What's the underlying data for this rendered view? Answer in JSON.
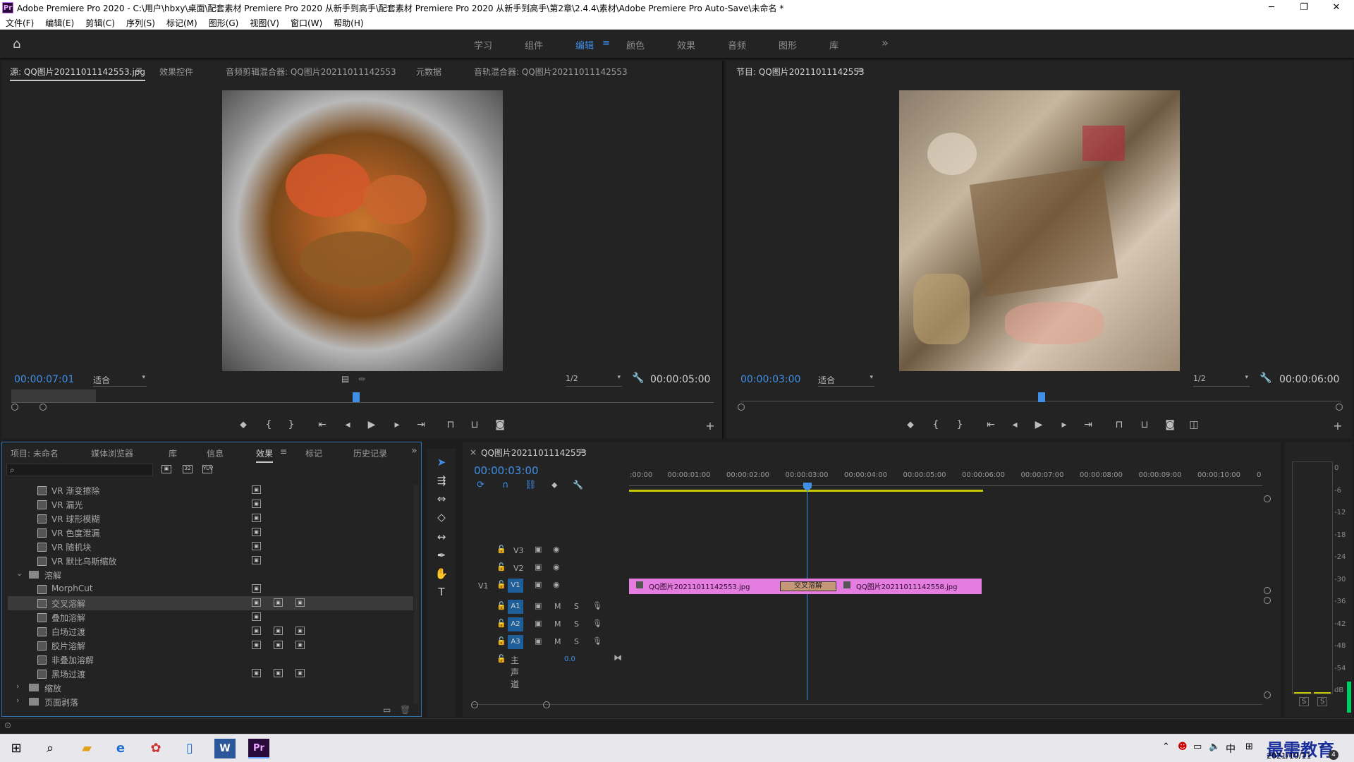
{
  "window": {
    "title": "Adobe Premiere Pro 2020 - C:\\用户\\hbxy\\桌面\\配套素材 Premiere Pro 2020 从新手到高手\\配套素材 Premiere Pro 2020 从新手到高手\\第2章\\2.4.4\\素材\\Adobe Premiere Pro Auto-Save\\未命名 *",
    "minimize": "─",
    "maximize": "❐",
    "close": "✕"
  },
  "menu": [
    "文件(F)",
    "编辑(E)",
    "剪辑(C)",
    "序列(S)",
    "标记(M)",
    "图形(G)",
    "视图(V)",
    "窗口(W)",
    "帮助(H)"
  ],
  "workspaces": [
    "学习",
    "组件",
    "编辑",
    "颜色",
    "效果",
    "音频",
    "图形",
    "库"
  ],
  "workspace_more": "»",
  "source": {
    "tabs": [
      "源: QQ图片20211011142553.jpg",
      "效果控件",
      "音频剪辑混合器: QQ图片20211011142553",
      "元数据",
      "音轨混合器: QQ图片20211011142553"
    ],
    "timecode": "00:00:07:01",
    "fit": "适合",
    "resolution": "1/2",
    "duration": "00:00:05:00"
  },
  "program": {
    "tab": "节目: QQ图片20211011142553",
    "timecode": "00:00:03:00",
    "fit": "适合",
    "resolution": "1/2",
    "duration": "00:00:06:00"
  },
  "project": {
    "tabs": [
      "项目: 未命名",
      "媒体浏览器",
      "库",
      "信息",
      "效果",
      "标记",
      "历史记录"
    ],
    "more": "»",
    "effects": [
      {
        "name": "VR 渐变擦除",
        "indent": 2,
        "badges": 1
      },
      {
        "name": "VR 漏光",
        "indent": 2,
        "badges": 1
      },
      {
        "name": "VR 球形模糊",
        "indent": 2,
        "badges": 1
      },
      {
        "name": "VR 色度泄漏",
        "indent": 2,
        "badges": 1
      },
      {
        "name": "VR 随机块",
        "indent": 2,
        "badges": 1
      },
      {
        "name": "VR 默比乌斯缩放",
        "indent": 2,
        "badges": 1
      },
      {
        "name": "溶解",
        "folder": true,
        "open": true
      },
      {
        "name": "MorphCut",
        "indent": 2,
        "badges": 1
      },
      {
        "name": "交叉溶解",
        "indent": 2,
        "badges": 3,
        "selected": true
      },
      {
        "name": "叠加溶解",
        "indent": 2,
        "badges": 1
      },
      {
        "name": "白场过渡",
        "indent": 2,
        "badges": 3
      },
      {
        "name": "胶片溶解",
        "indent": 2,
        "badges": 3
      },
      {
        "name": "非叠加溶解",
        "indent": 2,
        "badges": 0
      },
      {
        "name": "黑场过渡",
        "indent": 2,
        "badges": 3
      },
      {
        "name": "缩放",
        "folder": true,
        "open": false
      },
      {
        "name": "页面剥落",
        "folder": true,
        "open": false
      }
    ]
  },
  "timeline": {
    "tab": "QQ图片20211011142553",
    "timecode": "00:00:03:00",
    "ticks": [
      ":00:00",
      "00:00:01:00",
      "00:00:02:00",
      "00:00:03:00",
      "00:00:04:00",
      "00:00:05:00",
      "00:00:06:00",
      "00:00:07:00",
      "00:00:08:00",
      "00:00:09:00",
      "00:00:10:00",
      "0"
    ],
    "video_tracks": [
      "V3",
      "V2",
      "V1"
    ],
    "source_patch": "V1",
    "audio_tracks": [
      "A1",
      "A2",
      "A3"
    ],
    "master": "主声道",
    "master_value": "0.0",
    "clip1": "QQ图片20211011142553.jpg",
    "transition": "交叉溶解",
    "clip2": "QQ图片20211011142558.jpg",
    "mute": "M",
    "solo": "S"
  },
  "meter": {
    "scale": [
      "0",
      "-6",
      "-12",
      "-18",
      "-24",
      "-30",
      "-36",
      "-42",
      "-48",
      "-54",
      "dB"
    ],
    "solo_left": "S",
    "solo_right": "S"
  },
  "taskbar": {
    "time": "",
    "date": "2021/10/11",
    "lang": "中",
    "watermark": "最需教育",
    "notif": "4"
  }
}
